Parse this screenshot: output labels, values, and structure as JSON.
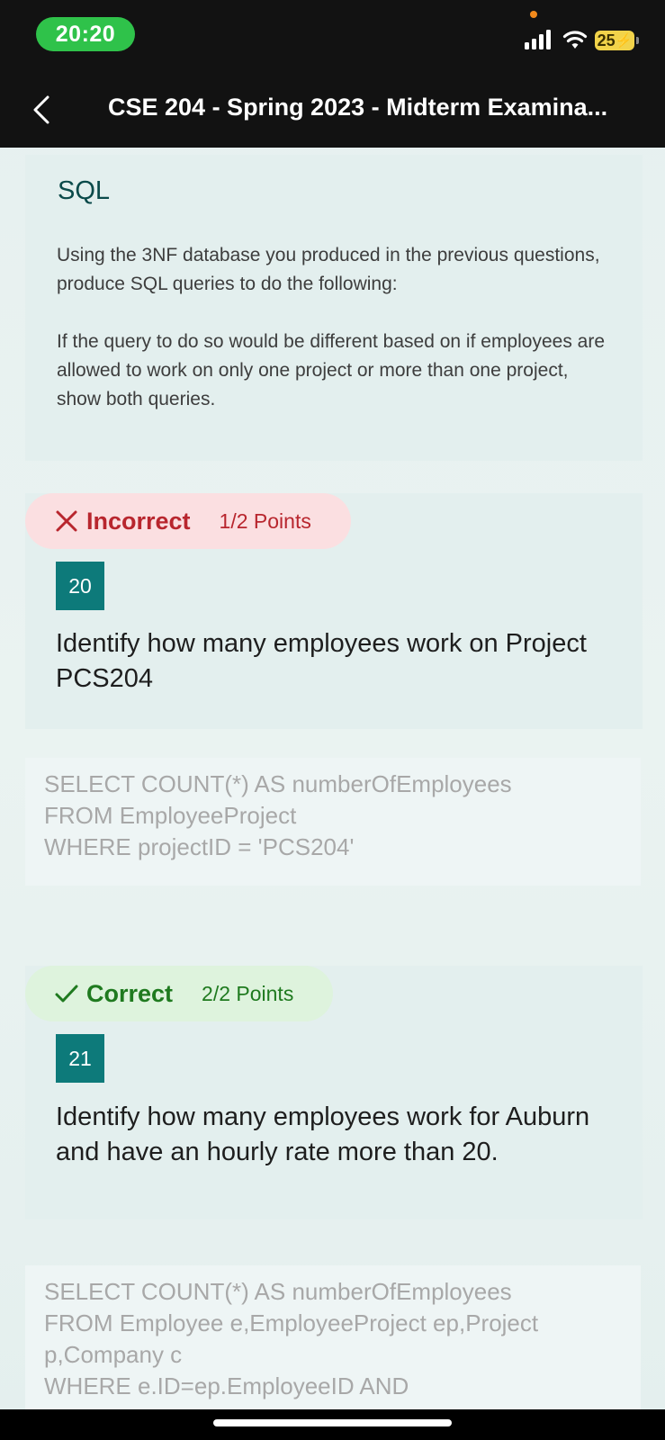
{
  "status_bar": {
    "time": "20:20",
    "battery": "25"
  },
  "header": {
    "title": "CSE 204 - Spring 2023 - Midterm Examina..."
  },
  "section": {
    "title": "SQL",
    "paragraph1": "Using the 3NF database you produced in the previous questions, produce SQL queries to do the following:",
    "paragraph2": "If the query to do so would be different based on if employees are allowed to work on only one project or more than one project, show both queries."
  },
  "questions": [
    {
      "result": "Incorrect",
      "points": "1/2 Points",
      "number": "20",
      "text": "Identify how many employees work on Project PCS204",
      "answer": "SELECT COUNT(*) AS numberOfEmployees\nFROM EmployeeProject\nWHERE projectID = 'PCS204'",
      "status_color": "#b8262e",
      "pill_bg": "#fbdfe1"
    },
    {
      "result": "Correct",
      "points": "2/2 Points",
      "number": "21",
      "text": "Identify how many employees work for Auburn and have an hourly rate more than 20.",
      "answer": "SELECT COUNT(*) AS numberOfEmployees\nFROM Employee e,EmployeeProject ep,Project p,Company c\nWHERE e.ID=ep.EmployeeID AND",
      "status_color": "#1f7a1f",
      "pill_bg": "#def3dd"
    }
  ],
  "colors": {
    "accent": "#0d7a7a",
    "status_green": "#2fc24a",
    "battery": "#f2d34a"
  }
}
